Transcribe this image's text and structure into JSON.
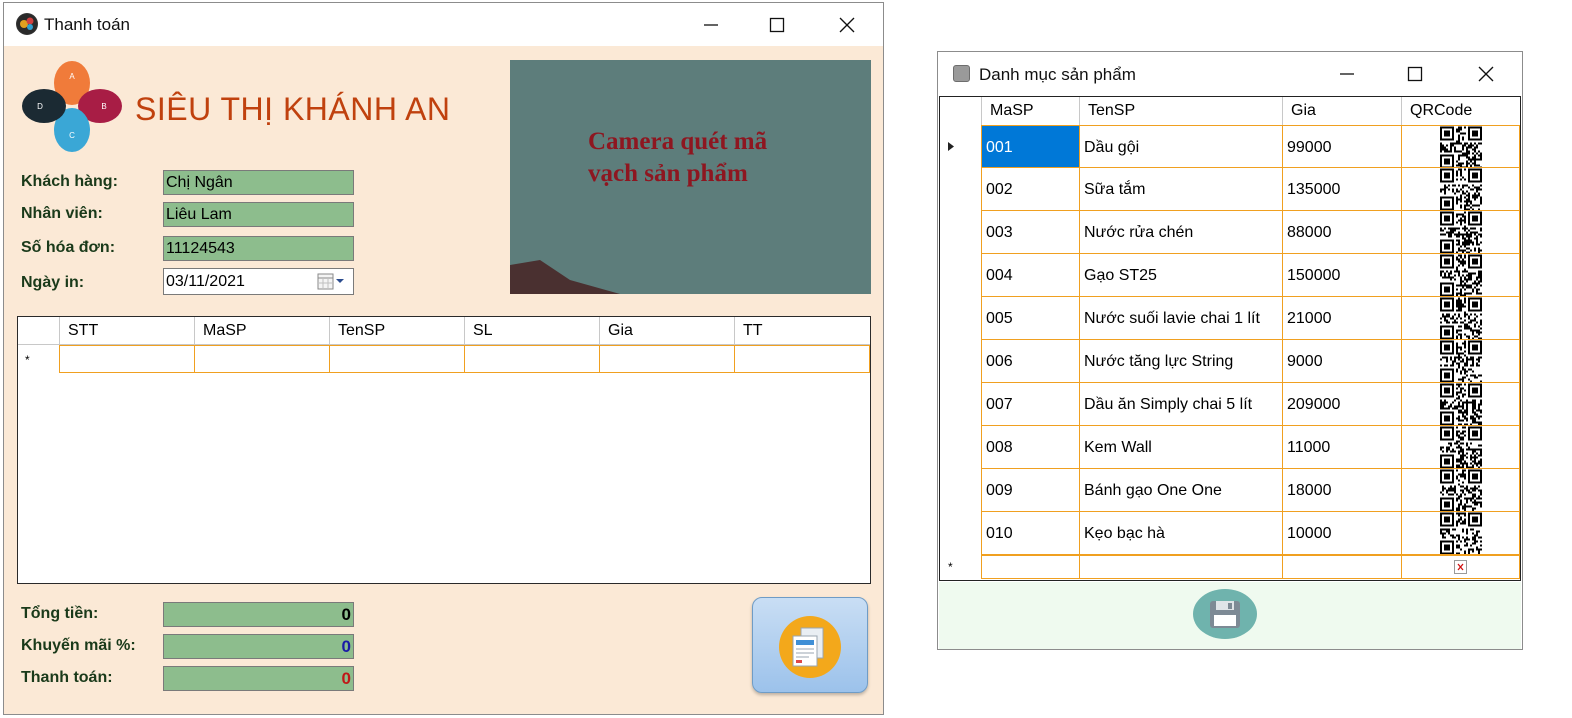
{
  "pay_window": {
    "title": "Thanh toán",
    "brand": "SIÊU THỊ KHÁNH AN",
    "logo_petals": [
      "A",
      "B",
      "C",
      "D"
    ],
    "camera_text_line1": "Camera quét mã",
    "camera_text_line2": "vạch sản phẩm",
    "customer_label": "Khách hàng:",
    "customer_value": "Chị Ngân",
    "staff_label": "Nhân viên:",
    "staff_value": "Liêu Lam",
    "invoice_label": "Số hóa đơn:",
    "invoice_value": "11124543",
    "date_label": "Ngày in:",
    "date_value": "03/11/2021",
    "grid_columns": [
      "STT",
      "MaSP",
      "TenSP",
      "SL",
      "Gia",
      "TT"
    ],
    "new_row_marker": "*",
    "total_label": "Tổng tiền:",
    "total_value": "0",
    "discount_label": "Khuyến mãi %:",
    "discount_value": "0",
    "pay_label": "Thanh toán:",
    "pay_value": "0",
    "colors": {
      "background": "#fbe9d6",
      "field": "#8dbd8d",
      "brand": "#c0410e",
      "discount_value": "#1a1aa6",
      "pay_value": "#c01818"
    }
  },
  "catalog_window": {
    "title": "Danh mục sản phẩm",
    "columns": [
      "MaSP",
      "TenSP",
      "Gia",
      "QRCode"
    ],
    "rows": [
      {
        "masp": "001",
        "tensp": "Dầu gội",
        "gia": "99000"
      },
      {
        "masp": "002",
        "tensp": "Sữa tắm",
        "gia": "135000"
      },
      {
        "masp": "003",
        "tensp": "Nước rửa chén",
        "gia": "88000"
      },
      {
        "masp": "004",
        "tensp": "Gạo ST25",
        "gia": "150000"
      },
      {
        "masp": "005",
        "tensp": "Nước suối lavie chai 1 lít",
        "gia": "21000"
      },
      {
        "masp": "006",
        "tensp": "Nước tăng lực String",
        "gia": "9000"
      },
      {
        "masp": "007",
        "tensp": "Dầu ăn Simply chai 5 lít",
        "gia": "209000"
      },
      {
        "masp": "008",
        "tensp": "Kem Wall",
        "gia": "11000"
      },
      {
        "masp": "009",
        "tensp": "Bánh gạo One One",
        "gia": "18000"
      },
      {
        "masp": "010",
        "tensp": "Kẹo bạc hà",
        "gia": "10000"
      }
    ],
    "new_row_marker": "*",
    "selected_cell": "001",
    "colors": {
      "selection": "#0078d7",
      "grid_line": "#f0a020",
      "bottom_panel": "#effaef",
      "save_button": "#6fb3ad"
    }
  }
}
